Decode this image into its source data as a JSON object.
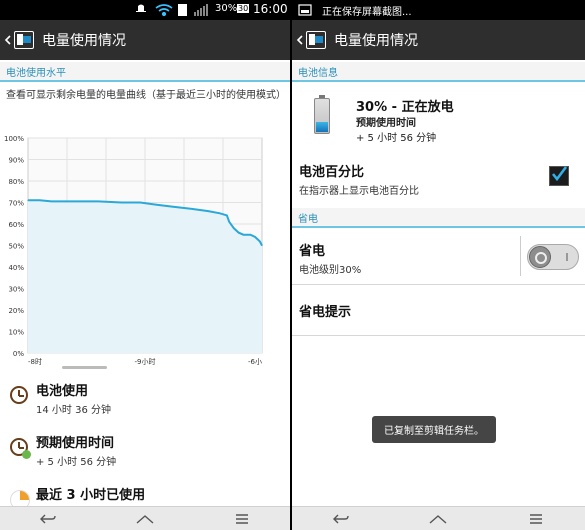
{
  "status": {
    "battery_pct": "30%",
    "time": "16:00",
    "notice_badge": "30",
    "screenshot_notice": "正在保存屏幕截图..."
  },
  "left": {
    "title": "电量使用情况",
    "section_header": "电池使用水平",
    "description": "查看可显示剩余电量的电量曲线（基于最近三小时的使用模式）",
    "stats": [
      {
        "title": "电池使用",
        "value": "14 小时 36 分钟",
        "icon": "clock-icon"
      },
      {
        "title": "预期使用时间",
        "value": "+ 5 小时 56 分钟",
        "icon": "clock-plus-icon"
      },
      {
        "title": "最近 3 小时已使用",
        "value": "",
        "icon": "pie-icon"
      }
    ]
  },
  "right": {
    "title": "电量使用情况",
    "section_info": "电池信息",
    "battery_status": "30% - 正在放电",
    "expected_label": "预期使用时间",
    "expected_value": "+ 5 小时 56 分钟",
    "percent_title": "电池百分比",
    "percent_desc": "在指示器上显示电池百分比",
    "percent_checked": true,
    "section_power": "省电",
    "powersave_title": "省电",
    "powersave_desc": "电池级别30%",
    "powersave_on": false,
    "tips_title": "省电提示",
    "toast": "已复制至剪辑任务栏。"
  },
  "chart_data": {
    "type": "area",
    "title": "",
    "xlabel": "",
    "ylabel": "",
    "ylim": [
      0,
      100
    ],
    "y_ticks": [
      "0%",
      "10%",
      "20%",
      "30%",
      "40%",
      "50%",
      "60%",
      "70%",
      "80%",
      "90%",
      "100%"
    ],
    "x_ticks": [
      "-8时",
      "-9小时",
      "-6小"
    ],
    "x": [
      0,
      0.05,
      0.1,
      0.2,
      0.3,
      0.4,
      0.48,
      0.55,
      0.62,
      0.7,
      0.77,
      0.82,
      0.85,
      0.86,
      0.88,
      0.9,
      0.92,
      0.95,
      0.97,
      0.99,
      1.0
    ],
    "values": [
      71,
      71,
      70.5,
      70.5,
      70.5,
      70,
      70,
      69,
      68,
      67,
      66,
      65,
      64,
      61,
      58,
      56,
      55,
      55,
      54,
      52,
      50
    ],
    "grid": true,
    "color": "#2aa8d8"
  }
}
